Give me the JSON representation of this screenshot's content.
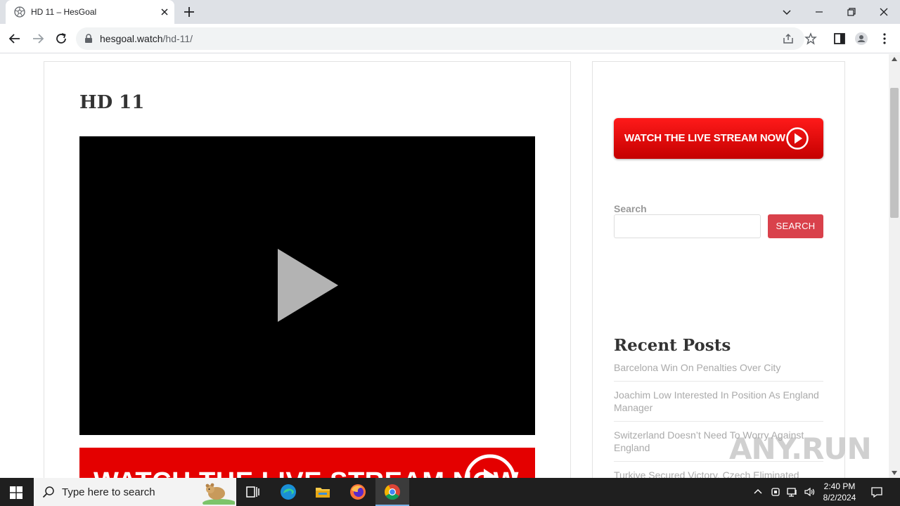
{
  "browser": {
    "tab_title": "HD 11 – HesGoal",
    "url_domain": "hesgoal.watch",
    "url_path": "/hd-11/"
  },
  "post": {
    "title": "HD 11",
    "banner_text": "WATCH THE LIVE STREAM NOW"
  },
  "sidebar": {
    "watch_button_label": "WATCH THE LIVE STREAM NOW",
    "search_label": "Search",
    "search_value": "",
    "search_button_label": "SEARCH",
    "recent_title": "Recent Posts",
    "recent_posts": [
      "Barcelona Win On Penalties Over City",
      "Joachim Low Interested In Position As England Manager",
      "Switzerland Doesn’t Need To Worry Against England",
      "Turkiye Secured Victory, Czech Eliminated"
    ]
  },
  "watermark": "ANY.RUN",
  "taskbar": {
    "search_placeholder": "Type here to search",
    "time": "2:40 PM",
    "date": "8/2/2024"
  },
  "colors": {
    "accent_red": "#e40000",
    "search_button": "#d9414b"
  }
}
